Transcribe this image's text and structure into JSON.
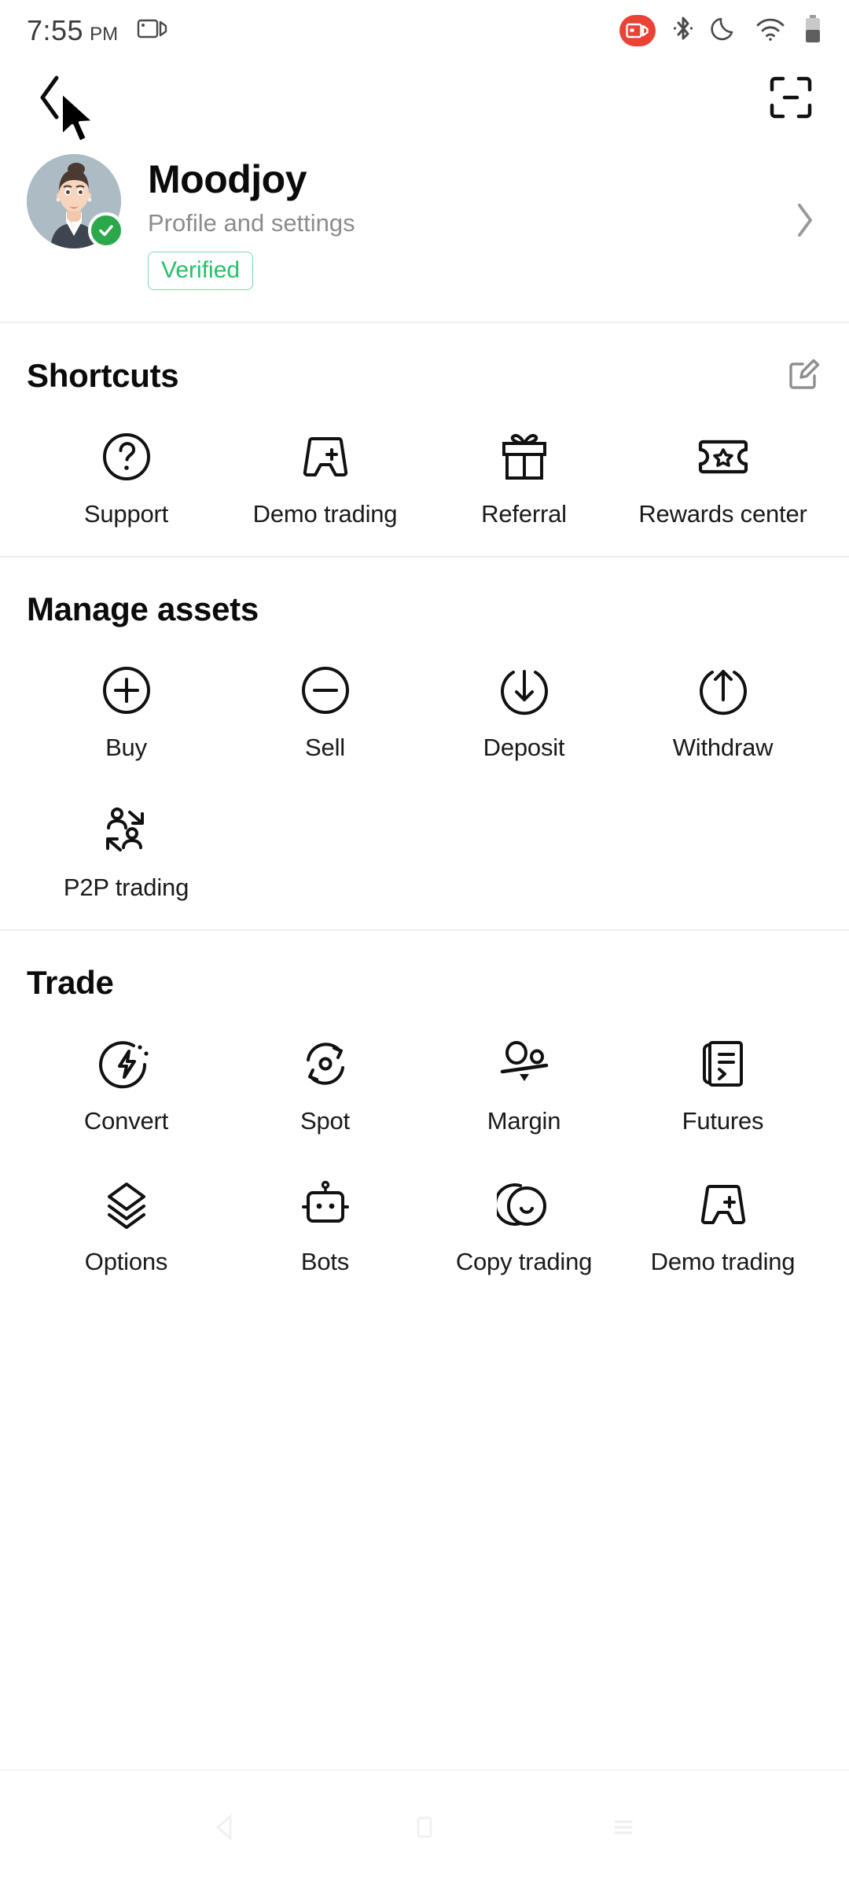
{
  "status_bar": {
    "time": "7:55",
    "am_pm": "PM",
    "icons": [
      "cast-icon",
      "screen-record-icon",
      "bluetooth-icon",
      "do-not-disturb-moon-icon",
      "wifi-icon",
      "battery-icon"
    ],
    "record_badge_color": "#ea4335"
  },
  "top_nav": {
    "back_icon": "chevron-left-icon",
    "scan_icon": "qr-scan-icon"
  },
  "profile": {
    "name": "Moodjoy",
    "subtitle": "Profile and settings",
    "badge": "Verified",
    "badge_color": "#25c16a",
    "avatar_icon": "user-avatar",
    "verified_icon": "check-circle-icon",
    "chevron_icon": "chevron-right-icon"
  },
  "shortcuts": {
    "title": "Shortcuts",
    "edit_icon": "edit-pencil-icon",
    "items": [
      {
        "label": "Support",
        "icon": "question-circle-icon"
      },
      {
        "label": "Demo trading",
        "icon": "game-controller-plus-icon"
      },
      {
        "label": "Referral",
        "icon": "gift-box-icon"
      },
      {
        "label": "Rewards center",
        "icon": "ticket-star-icon"
      }
    ]
  },
  "manage_assets": {
    "title": "Manage assets",
    "items": [
      {
        "label": "Buy",
        "icon": "plus-circle-icon"
      },
      {
        "label": "Sell",
        "icon": "minus-circle-icon"
      },
      {
        "label": "Deposit",
        "icon": "arrow-down-circle-icon"
      },
      {
        "label": "Withdraw",
        "icon": "arrow-up-circle-icon"
      },
      {
        "label": "P2P trading",
        "icon": "two-people-icon"
      }
    ]
  },
  "trade": {
    "title": "Trade",
    "items": [
      {
        "label": "Convert",
        "icon": "lightning-circle-icon"
      },
      {
        "label": "Spot",
        "icon": "refresh-circle-icon"
      },
      {
        "label": "Margin",
        "icon": "balance-scale-icon"
      },
      {
        "label": "Futures",
        "icon": "document-list-icon"
      },
      {
        "label": "Options",
        "icon": "layers-icon"
      },
      {
        "label": "Bots",
        "icon": "robot-icon"
      },
      {
        "label": "Copy trading",
        "icon": "copy-circles-icon"
      },
      {
        "label": "Demo trading",
        "icon": "game-controller-plus-icon"
      }
    ]
  },
  "bottom_nav": {
    "items": [
      {
        "icon": "android-back-icon"
      },
      {
        "icon": "android-home-icon"
      },
      {
        "icon": "android-recents-icon"
      }
    ]
  }
}
